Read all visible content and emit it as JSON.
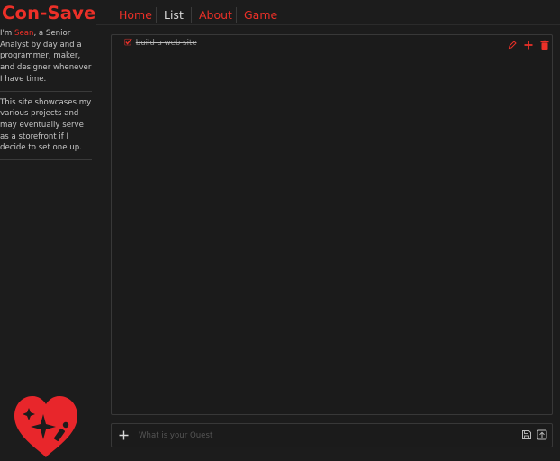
{
  "brand": {
    "name": "Con-Save"
  },
  "sidebar": {
    "bio_intro": "I'm ",
    "bio_name": "Sean",
    "bio_rest": ", a Senior Analyst by day and a programmer, maker, and designer whenever I have time.",
    "bio_second": "This site showcases my various projects and may eventually serve as a storefront if I decide to set one up."
  },
  "nav": {
    "items": [
      {
        "label": "Home",
        "active": false
      },
      {
        "label": "List",
        "active": true
      },
      {
        "label": "About",
        "active": false
      },
      {
        "label": "Game",
        "active": false
      }
    ]
  },
  "list": {
    "items": [
      {
        "text": "build a web site",
        "done": true
      }
    ]
  },
  "input": {
    "placeholder": "What is your Quest"
  },
  "icons": {
    "check": "checkmark-icon",
    "edit": "pencil-icon",
    "add": "plus-icon",
    "delete": "trash-icon",
    "new": "plus-icon",
    "save": "floppy-disk-icon",
    "upload": "upload-icon",
    "logo": "heart-sparkle-logo"
  },
  "colors": {
    "accent": "#ec3028",
    "background": "#1c1c1c",
    "text": "#d8d8d8"
  }
}
